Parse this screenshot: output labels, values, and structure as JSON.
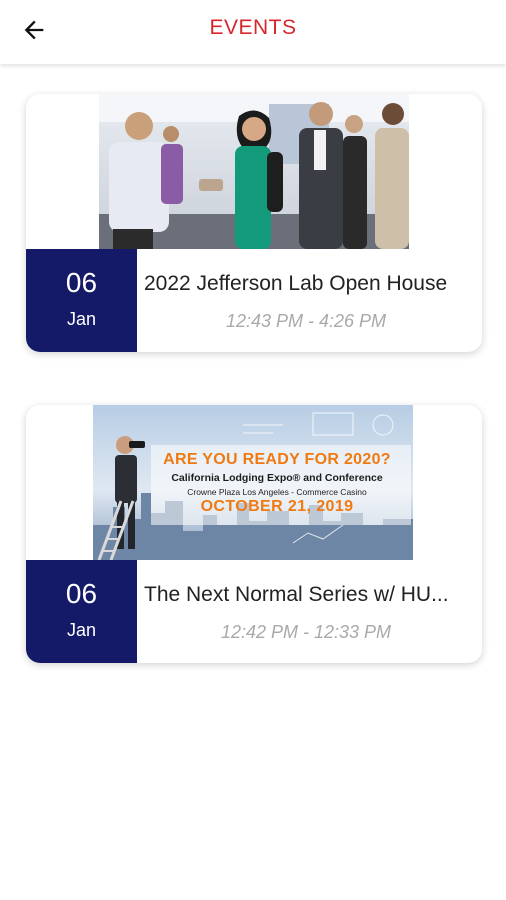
{
  "header": {
    "title": "EVENTS",
    "back_icon": "arrow-left-icon",
    "title_color": "#d9262c"
  },
  "events": [
    {
      "title": "2022 Jefferson Lab Open House",
      "day": "06",
      "month": "Jan",
      "time": "12:43 PM - 4:26 PM",
      "image": "networking-event-photo"
    },
    {
      "title": "The Next Normal Series w/ HU...",
      "day": "06",
      "month": "Jan",
      "time": "12:42 PM - 12:33 PM",
      "image": "lodging-expo-banner",
      "banner": {
        "line1": "ARE YOU READY FOR 2020?",
        "line2": "California Lodging Expo® and Conference",
        "line3": "Crowne Plaza Los Angeles - Commerce Casino",
        "line4": "OCTOBER 21, 2019"
      }
    }
  ],
  "colors": {
    "date_block": "#141a67",
    "time_text": "#a9a9a9",
    "banner_accent": "#f07a12"
  }
}
